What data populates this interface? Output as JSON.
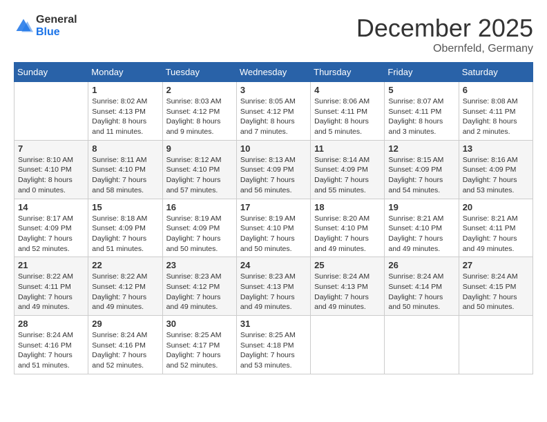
{
  "logo": {
    "text_general": "General",
    "text_blue": "Blue"
  },
  "header": {
    "month": "December 2025",
    "location": "Obernfeld, Germany"
  },
  "days_of_week": [
    "Sunday",
    "Monday",
    "Tuesday",
    "Wednesday",
    "Thursday",
    "Friday",
    "Saturday"
  ],
  "weeks": [
    [
      {
        "day": "",
        "info": ""
      },
      {
        "day": "1",
        "info": "Sunrise: 8:02 AM\nSunset: 4:13 PM\nDaylight: 8 hours\nand 11 minutes."
      },
      {
        "day": "2",
        "info": "Sunrise: 8:03 AM\nSunset: 4:12 PM\nDaylight: 8 hours\nand 9 minutes."
      },
      {
        "day": "3",
        "info": "Sunrise: 8:05 AM\nSunset: 4:12 PM\nDaylight: 8 hours\nand 7 minutes."
      },
      {
        "day": "4",
        "info": "Sunrise: 8:06 AM\nSunset: 4:11 PM\nDaylight: 8 hours\nand 5 minutes."
      },
      {
        "day": "5",
        "info": "Sunrise: 8:07 AM\nSunset: 4:11 PM\nDaylight: 8 hours\nand 3 minutes."
      },
      {
        "day": "6",
        "info": "Sunrise: 8:08 AM\nSunset: 4:11 PM\nDaylight: 8 hours\nand 2 minutes."
      }
    ],
    [
      {
        "day": "7",
        "info": "Sunrise: 8:10 AM\nSunset: 4:10 PM\nDaylight: 8 hours\nand 0 minutes."
      },
      {
        "day": "8",
        "info": "Sunrise: 8:11 AM\nSunset: 4:10 PM\nDaylight: 7 hours\nand 58 minutes."
      },
      {
        "day": "9",
        "info": "Sunrise: 8:12 AM\nSunset: 4:10 PM\nDaylight: 7 hours\nand 57 minutes."
      },
      {
        "day": "10",
        "info": "Sunrise: 8:13 AM\nSunset: 4:09 PM\nDaylight: 7 hours\nand 56 minutes."
      },
      {
        "day": "11",
        "info": "Sunrise: 8:14 AM\nSunset: 4:09 PM\nDaylight: 7 hours\nand 55 minutes."
      },
      {
        "day": "12",
        "info": "Sunrise: 8:15 AM\nSunset: 4:09 PM\nDaylight: 7 hours\nand 54 minutes."
      },
      {
        "day": "13",
        "info": "Sunrise: 8:16 AM\nSunset: 4:09 PM\nDaylight: 7 hours\nand 53 minutes."
      }
    ],
    [
      {
        "day": "14",
        "info": "Sunrise: 8:17 AM\nSunset: 4:09 PM\nDaylight: 7 hours\nand 52 minutes."
      },
      {
        "day": "15",
        "info": "Sunrise: 8:18 AM\nSunset: 4:09 PM\nDaylight: 7 hours\nand 51 minutes."
      },
      {
        "day": "16",
        "info": "Sunrise: 8:19 AM\nSunset: 4:09 PM\nDaylight: 7 hours\nand 50 minutes."
      },
      {
        "day": "17",
        "info": "Sunrise: 8:19 AM\nSunset: 4:10 PM\nDaylight: 7 hours\nand 50 minutes."
      },
      {
        "day": "18",
        "info": "Sunrise: 8:20 AM\nSunset: 4:10 PM\nDaylight: 7 hours\nand 49 minutes."
      },
      {
        "day": "19",
        "info": "Sunrise: 8:21 AM\nSunset: 4:10 PM\nDaylight: 7 hours\nand 49 minutes."
      },
      {
        "day": "20",
        "info": "Sunrise: 8:21 AM\nSunset: 4:11 PM\nDaylight: 7 hours\nand 49 minutes."
      }
    ],
    [
      {
        "day": "21",
        "info": "Sunrise: 8:22 AM\nSunset: 4:11 PM\nDaylight: 7 hours\nand 49 minutes."
      },
      {
        "day": "22",
        "info": "Sunrise: 8:22 AM\nSunset: 4:12 PM\nDaylight: 7 hours\nand 49 minutes."
      },
      {
        "day": "23",
        "info": "Sunrise: 8:23 AM\nSunset: 4:12 PM\nDaylight: 7 hours\nand 49 minutes."
      },
      {
        "day": "24",
        "info": "Sunrise: 8:23 AM\nSunset: 4:13 PM\nDaylight: 7 hours\nand 49 minutes."
      },
      {
        "day": "25",
        "info": "Sunrise: 8:24 AM\nSunset: 4:13 PM\nDaylight: 7 hours\nand 49 minutes."
      },
      {
        "day": "26",
        "info": "Sunrise: 8:24 AM\nSunset: 4:14 PM\nDaylight: 7 hours\nand 50 minutes."
      },
      {
        "day": "27",
        "info": "Sunrise: 8:24 AM\nSunset: 4:15 PM\nDaylight: 7 hours\nand 50 minutes."
      }
    ],
    [
      {
        "day": "28",
        "info": "Sunrise: 8:24 AM\nSunset: 4:16 PM\nDaylight: 7 hours\nand 51 minutes."
      },
      {
        "day": "29",
        "info": "Sunrise: 8:24 AM\nSunset: 4:16 PM\nDaylight: 7 hours\nand 52 minutes."
      },
      {
        "day": "30",
        "info": "Sunrise: 8:25 AM\nSunset: 4:17 PM\nDaylight: 7 hours\nand 52 minutes."
      },
      {
        "day": "31",
        "info": "Sunrise: 8:25 AM\nSunset: 4:18 PM\nDaylight: 7 hours\nand 53 minutes."
      },
      {
        "day": "",
        "info": ""
      },
      {
        "day": "",
        "info": ""
      },
      {
        "day": "",
        "info": ""
      }
    ]
  ]
}
